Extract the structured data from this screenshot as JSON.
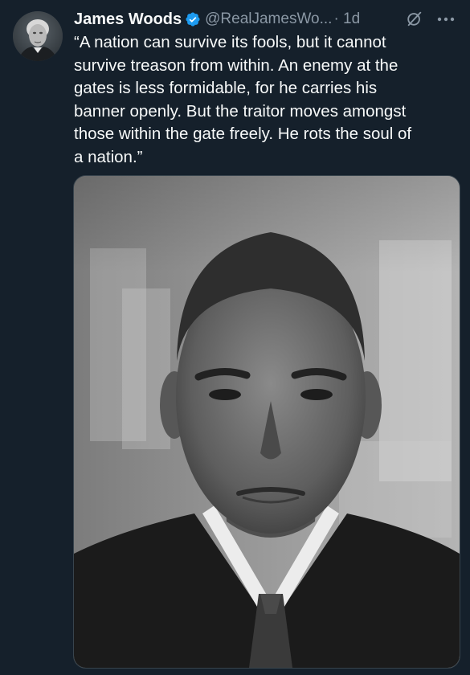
{
  "tweet": {
    "author": {
      "display_name": "James Woods",
      "handle": "@RealJamesWo...",
      "verified_icon": "verified-badge-icon",
      "avatar_icon": "avatar"
    },
    "time": "· 1d",
    "text": "“A nation can survive its fools, but it cannot\nsurvive treason from within. An enemy at the\ngates is less formidable, for he carries his\nbanner openly. But the traitor moves amongst\nthose within the gate freely. He rots the soul of\na nation.”",
    "actions": {
      "grok_icon": "grok-icon",
      "more_icon": "more-icon"
    },
    "media": {
      "type": "photo",
      "description_icon": "portrait-photo"
    }
  },
  "colors": {
    "background": "#15202b",
    "text_primary": "#f7f9f9",
    "text_secondary": "#8b98a5",
    "verified": "#1d9bf0",
    "border": "#38444d"
  }
}
